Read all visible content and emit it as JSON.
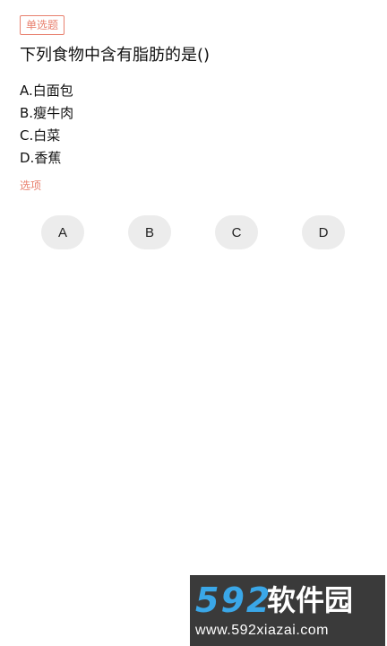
{
  "question": {
    "type_tag": "单选题",
    "text": "下列食物中含有脂肪的是()"
  },
  "options": [
    {
      "letter": "A.",
      "text": "白面包"
    },
    {
      "letter": "B.",
      "text": "瘦牛肉"
    },
    {
      "letter": "C.",
      "text": "白菜"
    },
    {
      "letter": "D.",
      "text": "香蕉"
    }
  ],
  "answer_section": {
    "label": "选项",
    "buttons": [
      "A",
      "B",
      "C",
      "D"
    ]
  },
  "watermark": {
    "logo_number": "592",
    "brand": "软件园",
    "url": "www.592xiazai.com"
  },
  "colors": {
    "accent": "#e8806e",
    "button_bg": "#ececec",
    "watermark_bg": "#3a3a3a",
    "watermark_logo": "#3aa7e8"
  }
}
